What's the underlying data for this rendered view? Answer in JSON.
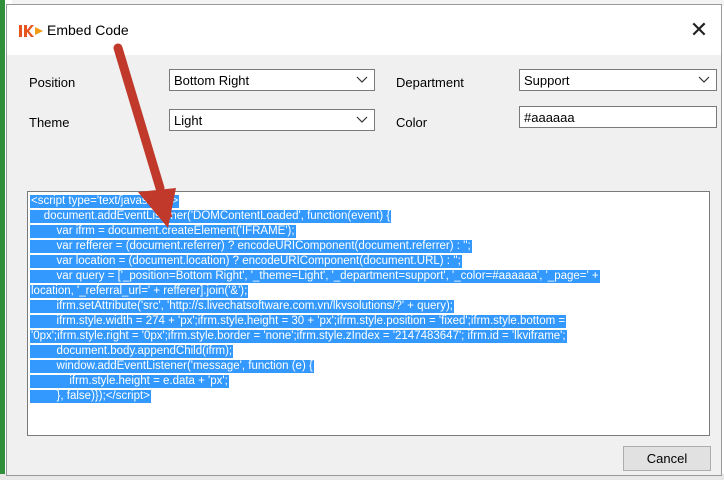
{
  "window": {
    "title": "Embed Code",
    "close_glyph": "✕",
    "logo_icon": "livechat-logo-icon"
  },
  "form": {
    "position_label": "Position",
    "position_value": "Bottom Right",
    "department_label": "Department",
    "department_value": "Support",
    "theme_label": "Theme",
    "theme_value": "Light",
    "color_label": "Color",
    "color_value": "#aaaaaa"
  },
  "code_lines": [
    "<script type='text/javascript'>",
    "    document.addEventListener('DOMContentLoaded', function(event) {",
    "        var ifrm = document.createElement('IFRAME');",
    "        var refferer = (document.referrer) ? encodeURIComponent(document.referrer) : '';",
    "        var location = (document.location) ? encodeURIComponent(document.URL) : '';",
    "        var query = ['_position=Bottom Right', '_theme=Light', '_department=support', '_color=#aaaaaa', '_page=' +",
    "location, '_referral_url=' + refferer].join('&');",
    "        ifrm.setAttribute('src', 'http://s.livechatsoftware.com.vn/lkvsolutions/?' + query);",
    "        ifrm.style.width = 274 + 'px';ifrm.style.height = 30 + 'px';ifrm.style.position = 'fixed';ifrm.style.bottom =",
    "'0px';ifrm.style.right = '0px';ifrm.style.border = 'none';ifrm.style.zIndex = '2147483647'; ifrm.id = 'lkviframe';",
    "        document.body.appendChild(ifrm);",
    "        window.addEventListener('message', function (e) {",
    "            ifrm.style.height = e.data + 'px';",
    "        }, false)});</script>"
  ],
  "buttons": {
    "cancel": "Cancel"
  },
  "colors": {
    "selection": "#3399ff",
    "arrow": "#c0392b",
    "dialog_bg": "#f0f0f0"
  }
}
